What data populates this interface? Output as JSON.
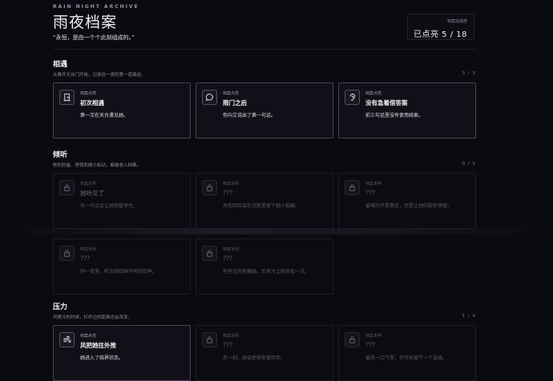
{
  "header": {
    "brand": "RAIN NIGHT ARCHIVE",
    "title": "雨夜档案",
    "quote": "“永恒，是由一个个此刻组成的。”",
    "progress_label": "档案完成度",
    "progress_text": "已点亮  5 / 18"
  },
  "sections": [
    {
      "title": "相遇",
      "subtitle": "从推开天台门开始，记录这一夜的第一道痕迹。",
      "count": "3 / 3",
      "cards": [
        {
          "status": "档案点亮",
          "name": "初次相遇",
          "desc": "第一次在天台遇见她。",
          "icon": "door-icon",
          "unlocked": true
        },
        {
          "status": "档案点亮",
          "name": "雨门之后",
          "desc": "你向艾说出了第一句话。",
          "icon": "chat-bubble-icon",
          "unlocked": true
        },
        {
          "status": "档案点亮",
          "name": "没有急着借答案",
          "desc": "前三句话里没有使用线索。",
          "icon": "ear-icon",
          "unlocked": true
        }
      ]
    },
    {
      "title": "倾听",
      "subtitle": "她的防备、停顿和微小松动，都被收入档案。",
      "count": "0 / 5",
      "cards": [
        {
          "status": "档案未明",
          "name": "她听见了",
          "desc": "有一句话会让她短暂停住。",
          "icon": "lock-icon",
          "unlocked": false
        },
        {
          "status": "档案未明",
          "name": "???",
          "desc": "有些回应会在沉默里留下细小裂缝。",
          "icon": "lock-icon",
          "unlocked": false
        },
        {
          "status": "档案未明",
          "name": "???",
          "desc": "最难的不是靠近，而是让她的脚步停留。",
          "icon": "lock-icon",
          "unlocked": false
        },
        {
          "status": "档案未明",
          "name": "???",
          "desc": "同一夜里，听见她四种不同的回声。",
          "icon": "lock-icon",
          "unlocked": false
        },
        {
          "status": "档案未明",
          "name": "???",
          "desc": "有些话先刺痛她，后来才让她放松一点。",
          "icon": "lock-icon",
          "unlocked": false
        }
      ]
    },
    {
      "title": "压力",
      "subtitle": "风更冷的时候，栏杆边的距离也会改变。",
      "count": "1 / 4",
      "cards": [
        {
          "status": "档案点亮",
          "name": "风把她往外推",
          "desc": "她进入了临界状态。",
          "icon": "wind-icon",
          "unlocked": true
        },
        {
          "status": "档案未明",
          "name": "???",
          "desc": "有一刻，她会把背影留给你。",
          "icon": "lock-icon",
          "unlocked": false
        },
        {
          "status": "档案未明",
          "name": "???",
          "desc": "最后一口气里，也可能留下一个选择。",
          "icon": "lock-icon",
          "unlocked": false
        }
      ]
    }
  ]
}
